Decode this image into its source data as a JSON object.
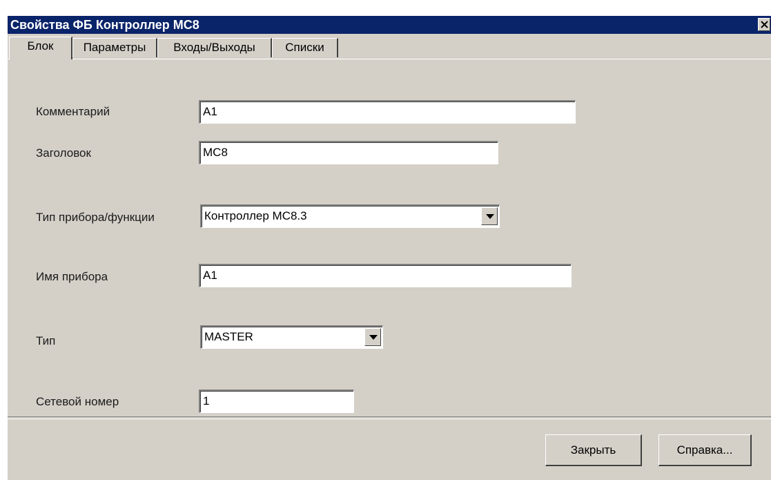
{
  "window": {
    "title": "Свойства ФБ Контроллер МС8"
  },
  "tabs": [
    {
      "label": "Блок",
      "active": true
    },
    {
      "label": "Параметры",
      "active": false
    },
    {
      "label": "Входы/Выходы",
      "active": false
    },
    {
      "label": "Списки",
      "active": false
    }
  ],
  "form": {
    "comment_label": "Комментарий",
    "comment_value": "A1",
    "header_label": "Заголовок",
    "header_value": "MC8",
    "device_type_label": "Тип прибора/функции",
    "device_type_value": "Контроллер МС8.3",
    "device_name_label": "Имя прибора",
    "device_name_value": "A1",
    "type_label": "Тип",
    "type_value": "MASTER",
    "net_number_label": "Сетевой номер",
    "net_number_value": "1"
  },
  "buttons": {
    "close_label": "Закрыть",
    "help_label": "Справка..."
  },
  "icons": {
    "close": "close-icon",
    "dropdown": "chevron-down-icon"
  },
  "colors": {
    "titlebar": "#0a246a",
    "face": "#d4d0c8"
  }
}
